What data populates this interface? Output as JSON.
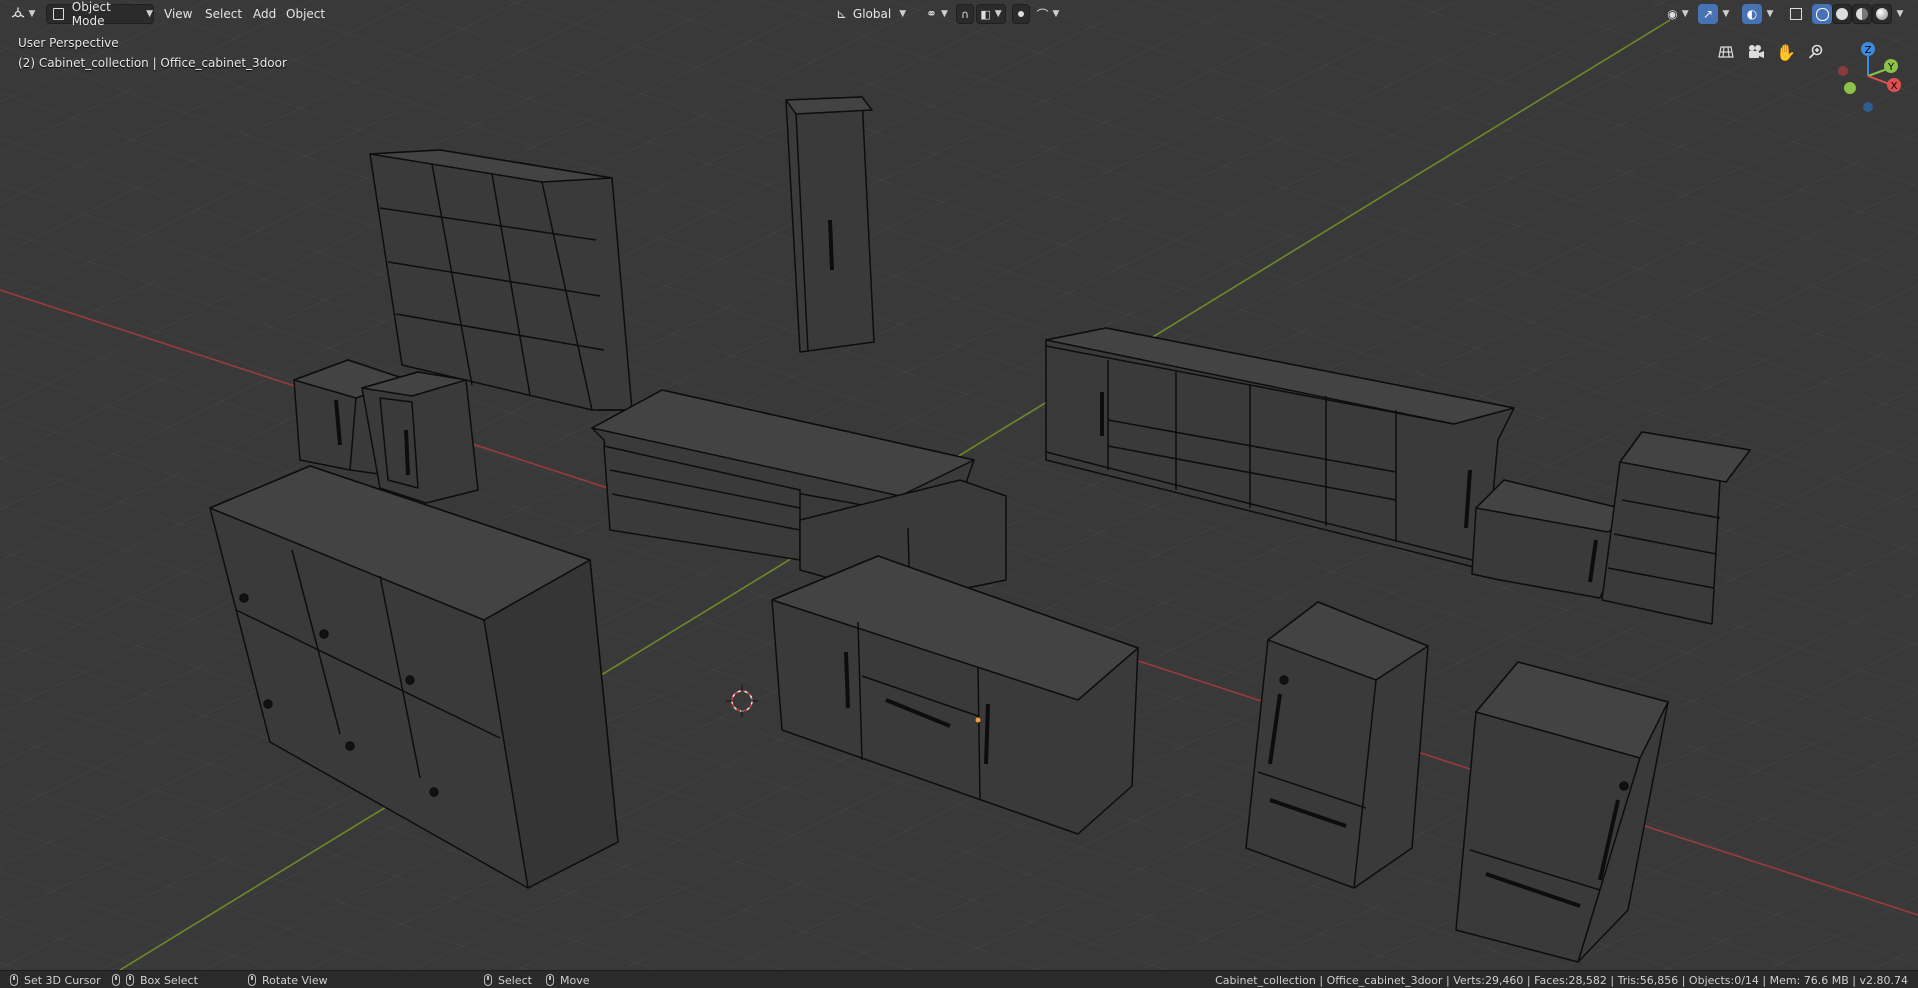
{
  "header": {
    "mode_label": "Object Mode",
    "menus": [
      "View",
      "Select",
      "Add",
      "Object"
    ],
    "transform_orientation": "Global"
  },
  "viewport": {
    "view_name": "User Perspective",
    "active_object": "(2) Cabinet_collection | Office_cabinet_3door",
    "gizmo_axes": {
      "x": "X",
      "y": "Y",
      "z": "Z"
    },
    "colors": {
      "background": "#393939",
      "x_axis": "#9a3b3b",
      "y_axis": "#6b8a27",
      "wire": "#000000",
      "gizmo_x": "#e05050",
      "gizmo_y": "#8bc34a",
      "gizmo_z": "#3d8be0"
    }
  },
  "statusbar": {
    "hints": [
      {
        "label": "Set 3D Cursor"
      },
      {
        "label": "Box Select"
      },
      {
        "label": "Rotate View"
      },
      {
        "label": "Select"
      },
      {
        "label": "Move"
      }
    ],
    "info": "Cabinet_collection | Office_cabinet_3door | Verts:29,460 | Faces:28,582 | Tris:56,856 | Objects:0/14 | Mem: 76.6 MB | v2.80.74"
  }
}
